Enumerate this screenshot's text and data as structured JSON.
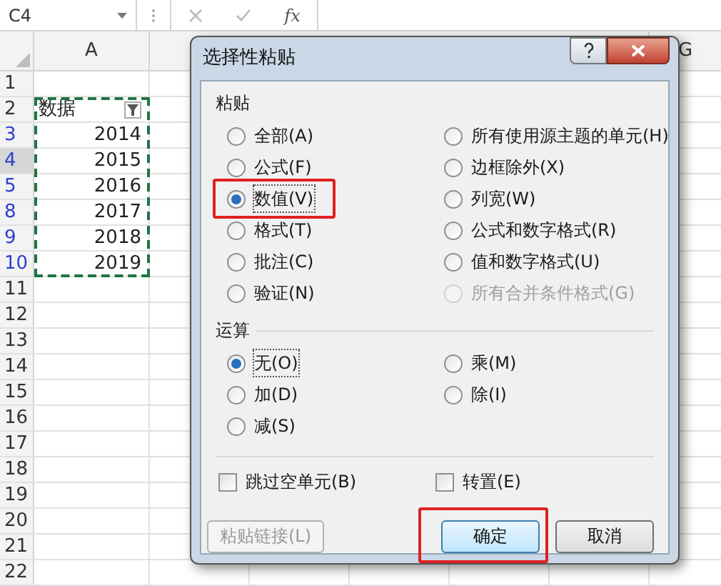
{
  "formula_bar": {
    "name_box": "C4",
    "function_label": "fx"
  },
  "sheet": {
    "columns": [
      {
        "label": "A"
      },
      {
        "label": "G"
      }
    ],
    "rows": [
      {
        "number": "1",
        "filtered": false,
        "selected": false
      },
      {
        "number": "2",
        "filtered": false,
        "selected": false,
        "value": "数据",
        "filter_button": true
      },
      {
        "number": "3",
        "filtered": true,
        "selected": false,
        "value": "2014"
      },
      {
        "number": "4",
        "filtered": true,
        "selected": true,
        "value": "2015"
      },
      {
        "number": "5",
        "filtered": true,
        "selected": false,
        "value": "2016"
      },
      {
        "number": "8",
        "filtered": true,
        "selected": false,
        "value": "2017"
      },
      {
        "number": "9",
        "filtered": true,
        "selected": false,
        "value": "2018"
      },
      {
        "number": "10",
        "filtered": true,
        "selected": false,
        "value": "2019"
      },
      {
        "number": "11",
        "filtered": false,
        "selected": false
      },
      {
        "number": "12",
        "filtered": false,
        "selected": false
      },
      {
        "number": "13",
        "filtered": false,
        "selected": false
      },
      {
        "number": "14",
        "filtered": false,
        "selected": false
      },
      {
        "number": "15",
        "filtered": false,
        "selected": false
      },
      {
        "number": "16",
        "filtered": false,
        "selected": false
      },
      {
        "number": "17",
        "filtered": false,
        "selected": false
      },
      {
        "number": "18",
        "filtered": false,
        "selected": false
      },
      {
        "number": "19",
        "filtered": false,
        "selected": false
      },
      {
        "number": "20",
        "filtered": false,
        "selected": false
      },
      {
        "number": "21",
        "filtered": false,
        "selected": false
      },
      {
        "number": "22",
        "filtered": false,
        "selected": false
      }
    ]
  },
  "dialog": {
    "title": "选择性粘贴",
    "paste_group": {
      "label": "粘贴",
      "options": [
        {
          "label": "全部(A)",
          "selected": false,
          "disabled": false,
          "highlighted": false
        },
        {
          "label": "公式(F)",
          "selected": false,
          "disabled": false,
          "highlighted": false
        },
        {
          "label": "数值(V)",
          "selected": true,
          "disabled": false,
          "highlighted": true
        },
        {
          "label": "格式(T)",
          "selected": false,
          "disabled": false,
          "highlighted": false
        },
        {
          "label": "批注(C)",
          "selected": false,
          "disabled": false,
          "highlighted": false
        },
        {
          "label": "验证(N)",
          "selected": false,
          "disabled": false,
          "highlighted": false
        },
        {
          "label": "所有使用源主题的单元(H)",
          "selected": false,
          "disabled": false,
          "highlighted": false
        },
        {
          "label": "边框除外(X)",
          "selected": false,
          "disabled": false,
          "highlighted": false
        },
        {
          "label": "列宽(W)",
          "selected": false,
          "disabled": false,
          "highlighted": false
        },
        {
          "label": "公式和数字格式(R)",
          "selected": false,
          "disabled": false,
          "highlighted": false
        },
        {
          "label": "值和数字格式(U)",
          "selected": false,
          "disabled": false,
          "highlighted": false
        },
        {
          "label": "所有合并条件格式(G)",
          "selected": false,
          "disabled": true,
          "highlighted": false
        }
      ]
    },
    "operation_group": {
      "label": "运算",
      "options": [
        {
          "label": "无(O)",
          "selected": true,
          "disabled": false,
          "highlighted": false
        },
        {
          "label": "加(D)",
          "selected": false,
          "disabled": false,
          "highlighted": false
        },
        {
          "label": "减(S)",
          "selected": false,
          "disabled": false,
          "highlighted": false
        },
        {
          "label": "乘(M)",
          "selected": false,
          "disabled": false,
          "highlighted": false
        },
        {
          "label": "除(I)",
          "selected": false,
          "disabled": false,
          "highlighted": false
        }
      ]
    },
    "checkboxes": [
      {
        "label": "跳过空单元(B)",
        "checked": false
      },
      {
        "label": "转置(E)",
        "checked": false
      }
    ],
    "buttons": [
      {
        "label": "粘贴链接(L)",
        "disabled": true,
        "highlighted": false,
        "default": false
      },
      {
        "label": "确定",
        "disabled": false,
        "highlighted": true,
        "default": true
      },
      {
        "label": "取消",
        "disabled": false,
        "highlighted": false,
        "default": false
      }
    ]
  }
}
